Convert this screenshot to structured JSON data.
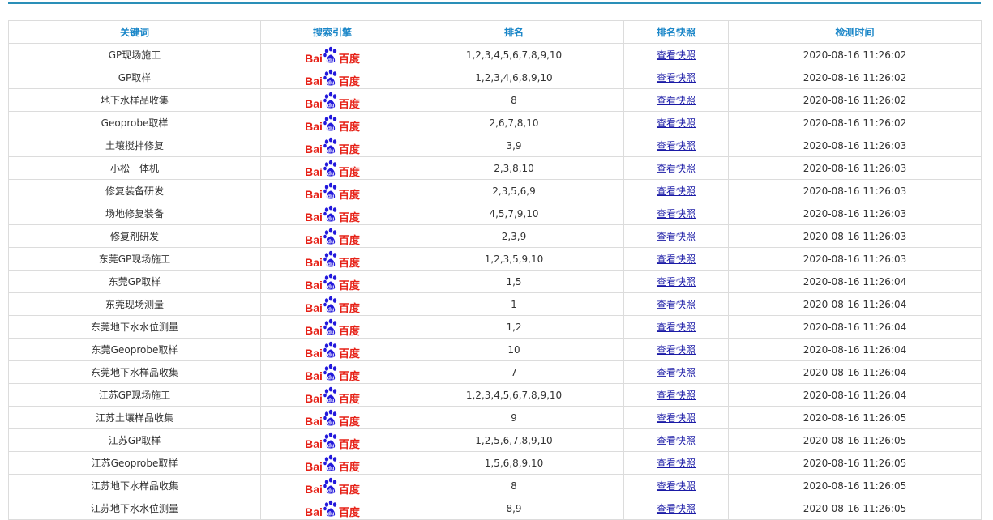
{
  "colors": {
    "header_text": "#1a86c8",
    "top_rule": "#2a8fb8",
    "link": "#1a1aa6",
    "baidu_red": "#e62117",
    "baidu_blue": "#2319dc"
  },
  "table": {
    "headers": [
      "关键词",
      "搜索引擎",
      "排名",
      "排名快照",
      "检测时间"
    ],
    "rows": [
      {
        "keyword": "GP现场施工",
        "engine_latin": "Bai",
        "engine_cn": "百度",
        "rank": "1,2,3,4,5,6,7,8,9,10",
        "snapshot": "查看快照",
        "time": "2020-08-16 11:26:02"
      },
      {
        "keyword": "GP取样",
        "engine_latin": "Bai",
        "engine_cn": "百度",
        "rank": "1,2,3,4,6,8,9,10",
        "snapshot": "查看快照",
        "time": "2020-08-16 11:26:02"
      },
      {
        "keyword": "地下水样品收集",
        "engine_latin": "Bai",
        "engine_cn": "百度",
        "rank": "8",
        "snapshot": "查看快照",
        "time": "2020-08-16 11:26:02"
      },
      {
        "keyword": "Geoprobe取样",
        "engine_latin": "Bai",
        "engine_cn": "百度",
        "rank": "2,6,7,8,10",
        "snapshot": "查看快照",
        "time": "2020-08-16 11:26:02"
      },
      {
        "keyword": "土壤搅拌修复",
        "engine_latin": "Bai",
        "engine_cn": "百度",
        "rank": "3,9",
        "snapshot": "查看快照",
        "time": "2020-08-16 11:26:03"
      },
      {
        "keyword": "小松一体机",
        "engine_latin": "Bai",
        "engine_cn": "百度",
        "rank": "2,3,8,10",
        "snapshot": "查看快照",
        "time": "2020-08-16 11:26:03"
      },
      {
        "keyword": "修复装备研发",
        "engine_latin": "Bai",
        "engine_cn": "百度",
        "rank": "2,3,5,6,9",
        "snapshot": "查看快照",
        "time": "2020-08-16 11:26:03"
      },
      {
        "keyword": "场地修复装备",
        "engine_latin": "Bai",
        "engine_cn": "百度",
        "rank": "4,5,7,9,10",
        "snapshot": "查看快照",
        "time": "2020-08-16 11:26:03"
      },
      {
        "keyword": "修复剂研发",
        "engine_latin": "Bai",
        "engine_cn": "百度",
        "rank": "2,3,9",
        "snapshot": "查看快照",
        "time": "2020-08-16 11:26:03"
      },
      {
        "keyword": "东莞GP现场施工",
        "engine_latin": "Bai",
        "engine_cn": "百度",
        "rank": "1,2,3,5,9,10",
        "snapshot": "查看快照",
        "time": "2020-08-16 11:26:03"
      },
      {
        "keyword": "东莞GP取样",
        "engine_latin": "Bai",
        "engine_cn": "百度",
        "rank": "1,5",
        "snapshot": "查看快照",
        "time": "2020-08-16 11:26:04"
      },
      {
        "keyword": "东莞现场测量",
        "engine_latin": "Bai",
        "engine_cn": "百度",
        "rank": "1",
        "snapshot": "查看快照",
        "time": "2020-08-16 11:26:04"
      },
      {
        "keyword": "东莞地下水水位测量",
        "engine_latin": "Bai",
        "engine_cn": "百度",
        "rank": "1,2",
        "snapshot": "查看快照",
        "time": "2020-08-16 11:26:04"
      },
      {
        "keyword": "东莞Geoprobe取样",
        "engine_latin": "Bai",
        "engine_cn": "百度",
        "rank": "10",
        "snapshot": "查看快照",
        "time": "2020-08-16 11:26:04"
      },
      {
        "keyword": "东莞地下水样品收集",
        "engine_latin": "Bai",
        "engine_cn": "百度",
        "rank": "7",
        "snapshot": "查看快照",
        "time": "2020-08-16 11:26:04"
      },
      {
        "keyword": "江苏GP现场施工",
        "engine_latin": "Bai",
        "engine_cn": "百度",
        "rank": "1,2,3,4,5,6,7,8,9,10",
        "snapshot": "查看快照",
        "time": "2020-08-16 11:26:04"
      },
      {
        "keyword": "江苏土壤样品收集",
        "engine_latin": "Bai",
        "engine_cn": "百度",
        "rank": "9",
        "snapshot": "查看快照",
        "time": "2020-08-16 11:26:05"
      },
      {
        "keyword": "江苏GP取样",
        "engine_latin": "Bai",
        "engine_cn": "百度",
        "rank": "1,2,5,6,7,8,9,10",
        "snapshot": "查看快照",
        "time": "2020-08-16 11:26:05"
      },
      {
        "keyword": "江苏Geoprobe取样",
        "engine_latin": "Bai",
        "engine_cn": "百度",
        "rank": "1,5,6,8,9,10",
        "snapshot": "查看快照",
        "time": "2020-08-16 11:26:05"
      },
      {
        "keyword": "江苏地下水样品收集",
        "engine_latin": "Bai",
        "engine_cn": "百度",
        "rank": "8",
        "snapshot": "查看快照",
        "time": "2020-08-16 11:26:05"
      },
      {
        "keyword": "江苏地下水水位测量",
        "engine_latin": "Bai",
        "engine_cn": "百度",
        "rank": "8,9",
        "snapshot": "查看快照",
        "time": "2020-08-16 11:26:05"
      }
    ]
  }
}
